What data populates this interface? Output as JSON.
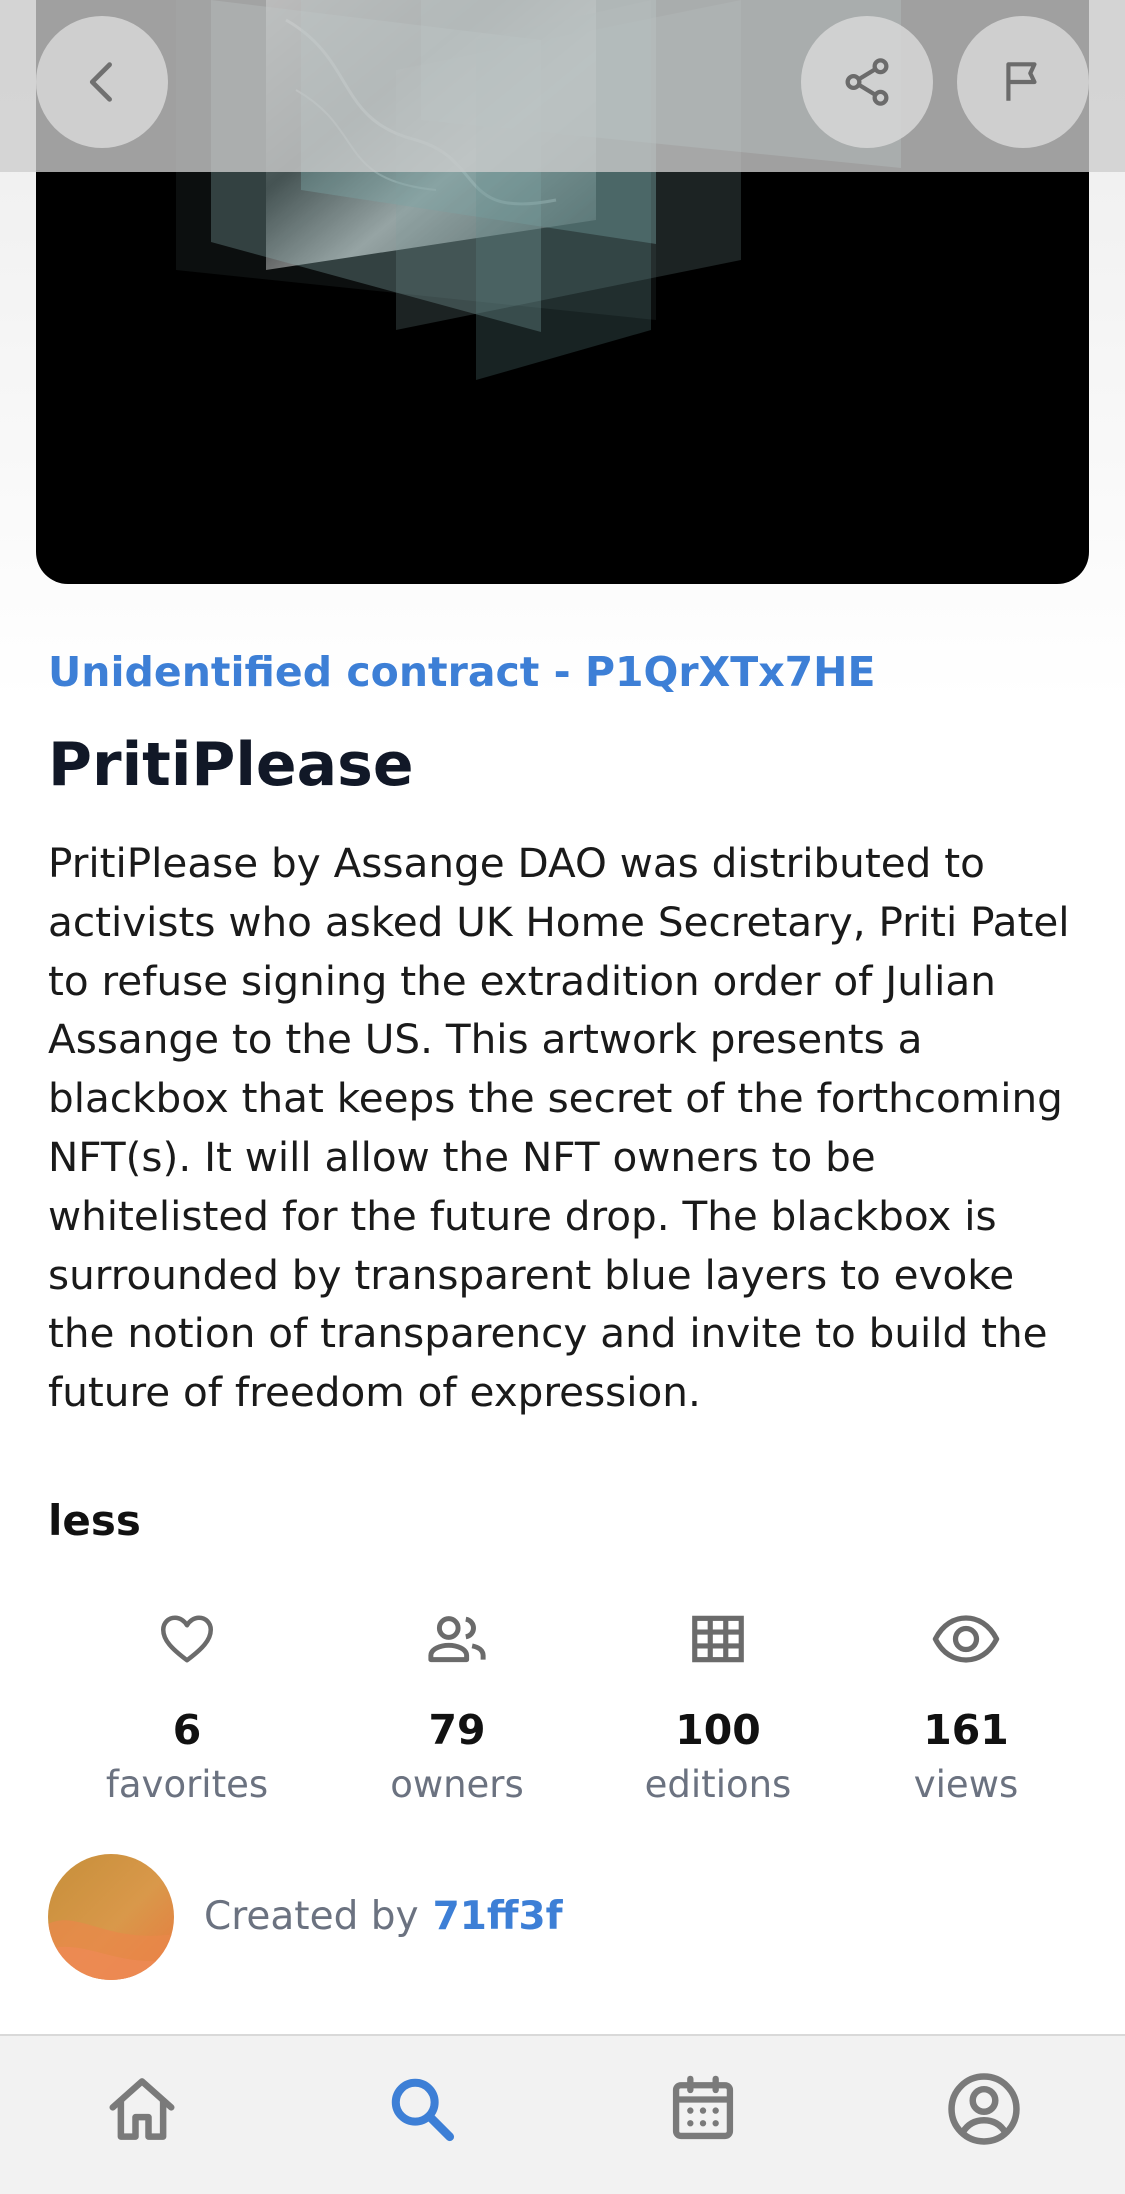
{
  "artwork": {
    "alt": "PritiPlease artwork"
  },
  "header": {
    "back_icon": "chevron-left-icon",
    "share_icon": "share-icon",
    "report_icon": "flag-icon"
  },
  "nft": {
    "contract": "Unidentified contract - P1QrXTx7HE",
    "title": "PritiPlease",
    "description": "PritiPlease by Assange DAO was distributed to activists who asked UK Home Secretary, Priti Patel to refuse signing the extradition order of Julian Assange to the US. This artwork presents a blackbox that keeps the secret of the forthcoming NFT(s).  It will allow the NFT owners to be whitelisted for the future drop. The blackbox is surrounded by transparent blue layers to evoke the notion of transparency and invite to build the future of freedom of expression.",
    "toggle_label": "less"
  },
  "stats": {
    "favorites": {
      "value": "6",
      "label": "favorites",
      "icon": "heart-icon"
    },
    "owners": {
      "value": "79",
      "label": "owners",
      "icon": "people-icon"
    },
    "editions": {
      "value": "100",
      "label": "editions",
      "icon": "grid-icon"
    },
    "views": {
      "value": "161",
      "label": "views",
      "icon": "eye-icon"
    }
  },
  "creator": {
    "label": "Created by",
    "username": "71ff3f"
  },
  "bottom_nav": {
    "items": [
      {
        "name": "home",
        "icon": "home-icon",
        "active": false
      },
      {
        "name": "search",
        "icon": "search-icon",
        "active": true
      },
      {
        "name": "calendar",
        "icon": "calendar-icon",
        "active": false
      },
      {
        "name": "profile",
        "icon": "profile-icon",
        "active": false
      }
    ]
  },
  "colors": {
    "accent": "#3d7fd6",
    "muted_text": "#6b7280",
    "icon_gray": "#6b6b6b"
  }
}
